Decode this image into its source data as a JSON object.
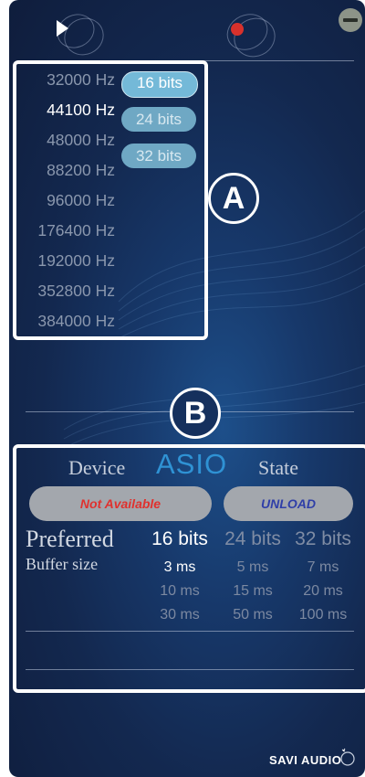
{
  "header": {
    "play_icon": "play-icon",
    "record_icon": "record-icon",
    "minimize_icon": "minimize-icon"
  },
  "sample_rates": {
    "items": [
      "32000 Hz",
      "44100 Hz",
      "48000 Hz",
      "88200 Hz",
      "96000 Hz",
      "176400 Hz",
      "192000 Hz",
      "352800 Hz",
      "384000 Hz"
    ],
    "selected": "44100 Hz"
  },
  "bit_depths": {
    "items": [
      "16 bits",
      "24 bits",
      "32 bits"
    ],
    "selected": "16 bits"
  },
  "markers": {
    "a": "A",
    "b": "B"
  },
  "device": {
    "device_label": "Device",
    "asio_label": "ASIO",
    "state_label": "State",
    "device_status": "Not Available",
    "state_action": "UNLOAD"
  },
  "buffer": {
    "preferred_label": "Preferred",
    "buffer_label": "Buffer size",
    "columns": [
      {
        "header": "16 bits",
        "values": [
          "3 ms",
          "10 ms",
          "30 ms"
        ]
      },
      {
        "header": "24 bits",
        "values": [
          "5 ms",
          "15 ms",
          "50 ms"
        ]
      },
      {
        "header": "32 bits",
        "values": [
          "7 ms",
          "20 ms",
          "100 ms"
        ]
      }
    ],
    "selected": "3 ms"
  },
  "footer": {
    "brand": "SAVI AUDIO"
  },
  "colors": {
    "accent_asio": "#2f92d4",
    "not_available": "#e0312e",
    "unload": "#2f3fa8",
    "record": "#d8312c"
  }
}
